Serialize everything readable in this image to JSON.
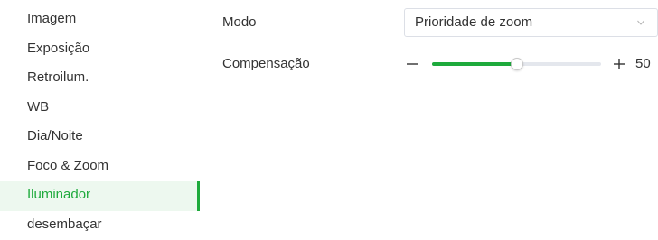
{
  "sidebar": {
    "items": [
      {
        "label": "Imagem"
      },
      {
        "label": "Exposição"
      },
      {
        "label": "Retroilum."
      },
      {
        "label": "WB"
      },
      {
        "label": "Dia/Noite"
      },
      {
        "label": "Foco & Zoom"
      },
      {
        "label": "Iluminador"
      },
      {
        "label": "desembaçar"
      }
    ],
    "active_index": 6
  },
  "settings": {
    "mode": {
      "label": "Modo",
      "value": "Prioridade de zoom"
    },
    "compensation": {
      "label": "Compensação",
      "value": "50",
      "min": 0,
      "max": 100
    }
  },
  "icons": {
    "dropdown": "chevron-down-icon",
    "decrement": "minus-icon",
    "increment": "plus-icon"
  },
  "colors": {
    "accent": "#1eaa3c",
    "active_bg": "#edf8ef",
    "text": "#333333",
    "track": "#e4e7ed",
    "border": "#dcdfe6"
  }
}
